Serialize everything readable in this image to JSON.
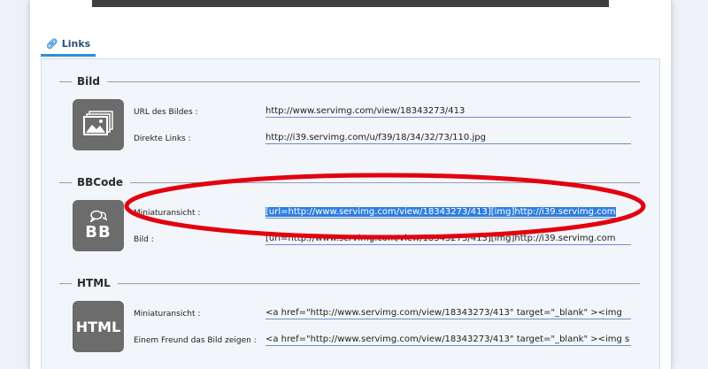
{
  "tab": {
    "label": "Links",
    "icon": "link-icon"
  },
  "colors": {
    "accent": "#2d8ed6",
    "icon_bg": "#6c6c6c",
    "highlight": "#2f7fe0",
    "annotation": "#e3000f"
  },
  "sections": {
    "bild": {
      "title": "Bild",
      "icon": "image-gallery-icon",
      "fields": [
        {
          "label": "URL des Bildes :",
          "value": "http://www.servimg.com/view/18343273/413"
        },
        {
          "label": "Direkte Links :",
          "value": "http://i39.servimg.com/u/f39/18/34/32/73/110.jpg"
        }
      ]
    },
    "bbcode": {
      "title": "BBCode",
      "icon_text": "BB",
      "fields": [
        {
          "label": "Miniaturansicht :",
          "value": "[url=http://www.servimg.com/view/18343273/413][img]http://i39.servimg.com"
        },
        {
          "label": "Bild :",
          "value": "[url=http://www.servimg.com/view/18343273/413][img]http://i39.servimg.com"
        }
      ]
    },
    "html": {
      "title": "HTML",
      "icon_text": "HTML",
      "fields": [
        {
          "label": "Miniaturansicht :",
          "value": "<a href=\"http://www.servimg.com/view/18343273/413\"  target=\"_blank\" ><img"
        },
        {
          "label": "Einem Freund das Bild zeigen :",
          "value": "<a href=\"http://www.servimg.com/view/18343273/413\" target=\"_blank\" ><img s"
        }
      ]
    }
  }
}
